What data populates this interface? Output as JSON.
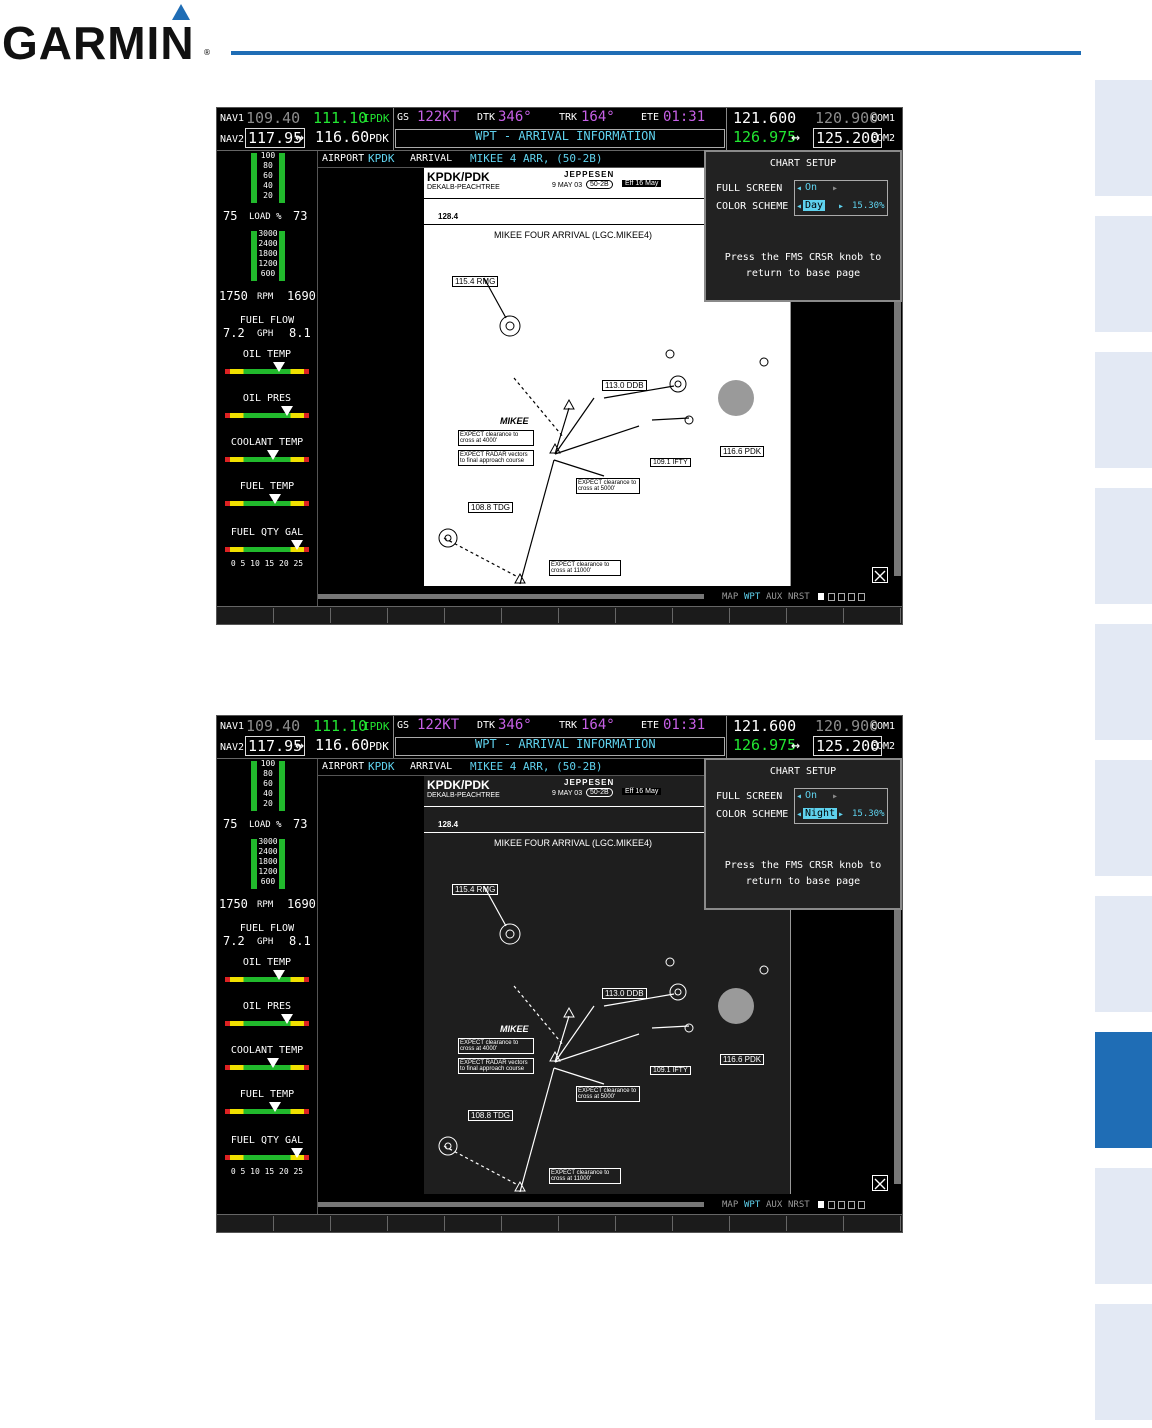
{
  "brand": {
    "name": "GARMIN",
    "mark": "®"
  },
  "screens": [
    {
      "status": {
        "nav1_label": "NAV1",
        "nav1_standby": "109.40",
        "nav1_active": "111.10",
        "nav1_ident": "IPDK",
        "nav2_label": "NAV2",
        "nav2_active": "117.95",
        "nav2_arrow": "↔",
        "nav2_standby": "116.60",
        "nav2_ident": "PDK",
        "gs_label": "GS",
        "gs_value": "122KT",
        "dtk_label": "DTK",
        "dtk_value": "346°",
        "trk_label": "TRK",
        "trk_value": "164°",
        "ete_label": "ETE",
        "ete_value": "01:31",
        "page_title": "WPT - ARRIVAL INFORMATION",
        "com1_active": "121.600",
        "com1_standby": "120.900",
        "com1_label": "COM1",
        "com2_active": "126.975",
        "com2_arrow": "↔",
        "com2_standby": "125.200",
        "com2_label": "COM2"
      },
      "eis": {
        "load_scale": [
          "100",
          "80",
          "60",
          "40",
          "20"
        ],
        "load_left": "75",
        "load_label": "LOAD %",
        "load_right": "73",
        "rpm_scale": [
          "3000",
          "2400",
          "1800",
          "1200",
          "600"
        ],
        "rpm_left": "1750",
        "rpm_label": "RPM",
        "rpm_right": "1690",
        "fuel_flow_label": "FUEL FLOW",
        "fuel_flow_left": "7.2",
        "fuel_flow_unit": "GPH",
        "fuel_flow_right": "8.1",
        "oil_temp": "OIL TEMP",
        "oil_pres": "OIL PRES",
        "coolant_temp": "COOLANT TEMP",
        "fuel_temp": "FUEL TEMP",
        "fuel_qty": "FUEL QTY GAL",
        "fuel_scale": "0  5  10 15 20 25"
      },
      "nav": {
        "airport_label": "AIRPORT",
        "airport_value": "KPDK",
        "arrival_label": "ARRIVAL",
        "arrival_value": "MIKEE 4 ARR, (50-2B)"
      },
      "chart": {
        "airport": "KPDK/PDK",
        "city": "DEKALB-PEACHTREE",
        "publisher": "JEPPESEN",
        "date": "9 MAY 03",
        "chart_no": "50-2B",
        "eff": "Eff 16 May",
        "freq": "128.4",
        "title": "MIKEE FOUR ARRIVAL (LGC.MIKEE4)",
        "rmg": "115.4 RMG",
        "ddb": "113.0 DDB",
        "pdk": "116.6 PDK",
        "tdg": "108.8 TDG",
        "ifty": "109.1 IFTY",
        "mikee": "MIKEE",
        "expect4000": "EXPECT clearance to cross at 4000'",
        "expect5000": "EXPECT clearance to cross at 5000'",
        "expect11000": "EXPECT clearance to cross at 11000'",
        "radar": "EXPECT RADAR vectors to final approach course"
      },
      "popup": {
        "title": "CHART SETUP",
        "full_screen_label": "FULL SCREEN",
        "full_screen_value": "On",
        "color_label": "COLOR SCHEME",
        "color_value": "Day",
        "brightness": "15.30%",
        "help": "Press the FMS CRSR knob to return to base page"
      },
      "pages": {
        "map": "MAP",
        "wpt": "WPT",
        "aux": "AUX",
        "nrst": "NRST"
      }
    },
    {
      "status": {
        "nav1_label": "NAV1",
        "nav1_standby": "109.40",
        "nav1_active": "111.10",
        "nav1_ident": "IPDK",
        "nav2_label": "NAV2",
        "nav2_active": "117.95",
        "nav2_arrow": "↔",
        "nav2_standby": "116.60",
        "nav2_ident": "PDK",
        "gs_label": "GS",
        "gs_value": "122KT",
        "dtk_label": "DTK",
        "dtk_value": "346°",
        "trk_label": "TRK",
        "trk_value": "164°",
        "ete_label": "ETE",
        "ete_value": "01:31",
        "page_title": "WPT - ARRIVAL INFORMATION",
        "com1_active": "121.600",
        "com1_standby": "120.900",
        "com1_label": "COM1",
        "com2_active": "126.975",
        "com2_arrow": "↔",
        "com2_standby": "125.200",
        "com2_label": "COM2"
      },
      "eis": {
        "load_scale": [
          "100",
          "80",
          "60",
          "40",
          "20"
        ],
        "load_left": "75",
        "load_label": "LOAD %",
        "load_right": "73",
        "rpm_scale": [
          "3000",
          "2400",
          "1800",
          "1200",
          "600"
        ],
        "rpm_left": "1750",
        "rpm_label": "RPM",
        "rpm_right": "1690",
        "fuel_flow_label": "FUEL FLOW",
        "fuel_flow_left": "7.2",
        "fuel_flow_unit": "GPH",
        "fuel_flow_right": "8.1",
        "oil_temp": "OIL TEMP",
        "oil_pres": "OIL PRES",
        "coolant_temp": "COOLANT TEMP",
        "fuel_temp": "FUEL TEMP",
        "fuel_qty": "FUEL QTY GAL",
        "fuel_scale": "0  5  10 15 20 25"
      },
      "nav": {
        "airport_label": "AIRPORT",
        "airport_value": "KPDK",
        "arrival_label": "ARRIVAL",
        "arrival_value": "MIKEE 4 ARR, (50-2B)"
      },
      "chart": {
        "airport": "KPDK/PDK",
        "city": "DEKALB-PEACHTREE",
        "publisher": "JEPPESEN",
        "date": "9 MAY 03",
        "chart_no": "50-2B",
        "eff": "Eff 16 May",
        "freq": "128.4",
        "title": "MIKEE FOUR ARRIVAL (LGC.MIKEE4)",
        "rmg": "115.4 RMG",
        "ddb": "113.0 DDB",
        "pdk": "116.6 PDK",
        "tdg": "108.8 TDG",
        "ifty": "109.1 IFTY",
        "mikee": "MIKEE",
        "expect4000": "EXPECT clearance to cross at 4000'",
        "expect5000": "EXPECT clearance to cross at 5000'",
        "expect11000": "EXPECT clearance to cross at 11000'",
        "radar": "EXPECT RADAR vectors to final approach course"
      },
      "popup": {
        "title": "CHART SETUP",
        "full_screen_label": "FULL SCREEN",
        "full_screen_value": "On",
        "color_label": "COLOR SCHEME",
        "color_value": "Night",
        "brightness": "15.30%",
        "help": "Press the FMS CRSR knob to return to base page"
      },
      "pages": {
        "map": "MAP",
        "wpt": "WPT",
        "aux": "AUX",
        "nrst": "NRST"
      }
    }
  ]
}
